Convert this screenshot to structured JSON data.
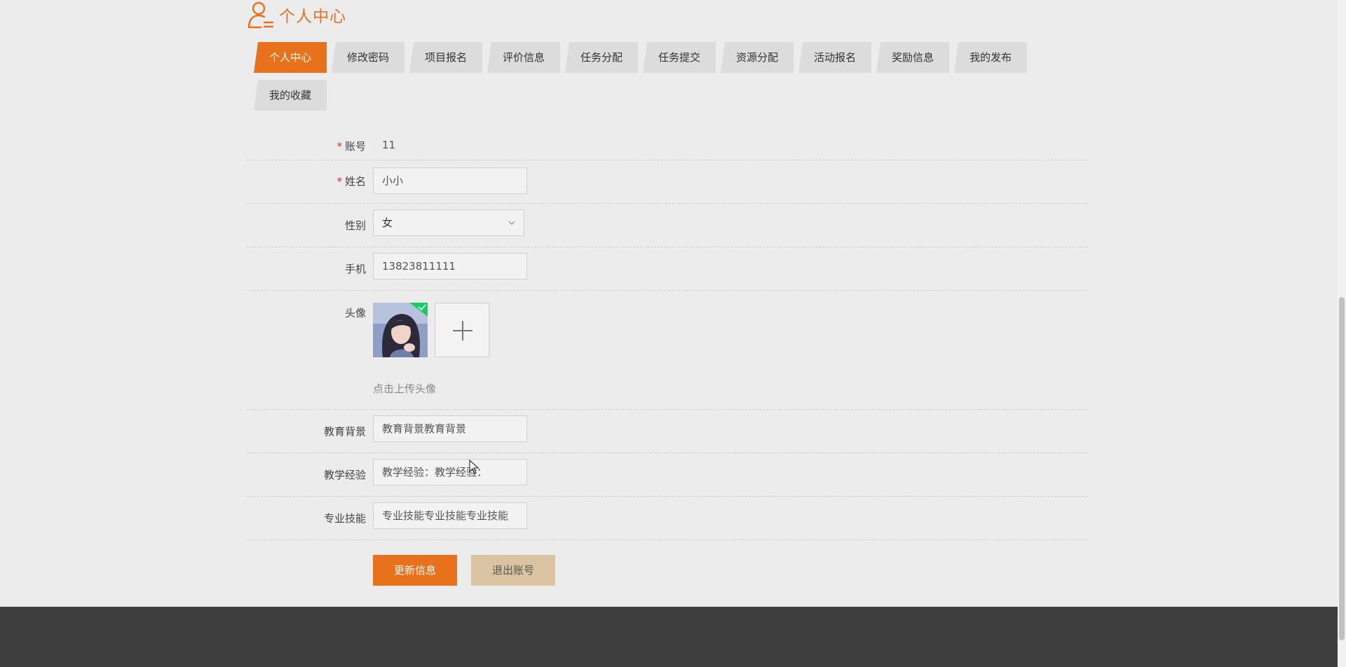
{
  "page": {
    "title": "个人中心"
  },
  "tabs": [
    {
      "label": "个人中心",
      "active": true
    },
    {
      "label": "修改密码"
    },
    {
      "label": "项目报名"
    },
    {
      "label": "评价信息"
    },
    {
      "label": "任务分配"
    },
    {
      "label": "任务提交"
    },
    {
      "label": "资源分配"
    },
    {
      "label": "活动报名"
    },
    {
      "label": "奖励信息"
    },
    {
      "label": "我的发布"
    },
    {
      "label": "我的收藏"
    }
  ],
  "form": {
    "account": {
      "required_mark": "*",
      "label": "账号",
      "value": "11"
    },
    "name": {
      "required_mark": "*",
      "label": "姓名",
      "value": "小小"
    },
    "gender": {
      "label": "性别",
      "value": "女"
    },
    "phone": {
      "label": "手机",
      "value": "13823811111"
    },
    "avatar": {
      "label": "头像",
      "hint": "点击上传头像"
    },
    "education": {
      "label": "教育背景",
      "value": "教育背景教育背景"
    },
    "teaching": {
      "label": "教学经验",
      "value": "教学经验：教学经验："
    },
    "skills": {
      "label": "专业技能",
      "value": "专业技能专业技能专业技能"
    }
  },
  "buttons": {
    "update": "更新信息",
    "logout": "退出账号"
  },
  "colors": {
    "accent": "#e8721c",
    "secondary": "#d9c3a0",
    "footer": "#3e3e3e"
  }
}
